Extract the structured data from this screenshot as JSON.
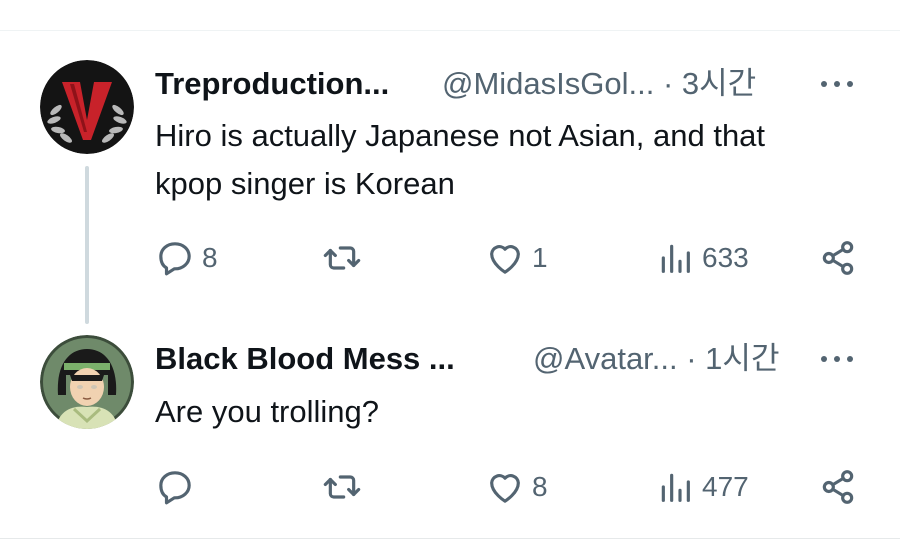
{
  "tweets": [
    {
      "display_name": "Treproduction...",
      "handle_time": "@MidasIsGol... · 3시간",
      "text": "Hiro is actually Japanese not Asian, and that kpop singer is Korean",
      "replies": "8",
      "retweets": "",
      "likes": "1",
      "views": "633",
      "avatar_icon": "red-v-logo-icon"
    },
    {
      "display_name": "Black Blood Mess ...",
      "handle_time": "@Avatar... · 1시간",
      "text": "Are you trolling?",
      "replies": "",
      "retweets": "",
      "likes": "8",
      "views": "477",
      "avatar_icon": "cartoon-character-icon"
    }
  ],
  "colors": {
    "text": "#0f1419",
    "secondary": "#536471",
    "thread_line": "#cfd9de",
    "avatar_red": "#c8222a"
  },
  "icons": [
    "more-icon",
    "reply-icon",
    "retweet-icon",
    "like-icon",
    "views-icon",
    "share-icon"
  ]
}
